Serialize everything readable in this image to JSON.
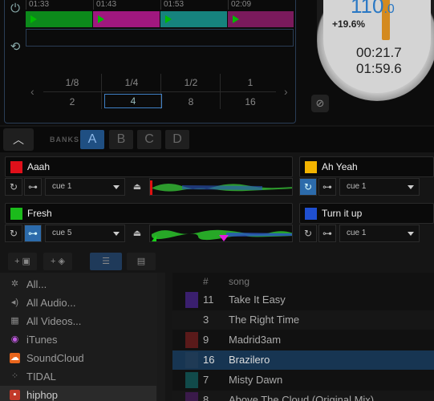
{
  "top": {
    "times": [
      "01:33",
      "01:43",
      "01:53",
      "02:09"
    ],
    "clip_colors": [
      "#0c8a1b",
      "#a0187f",
      "#16837e",
      "#7a1a5c"
    ],
    "loop_icon": "loop-icon",
    "sync_icon": "sync-icon",
    "beat_top": [
      "1/8",
      "1/4",
      "1/2",
      "1"
    ],
    "beat_bottom": [
      "2",
      "4",
      "8",
      "16"
    ],
    "beat_selected": "4"
  },
  "jog": {
    "bpm_main": "110",
    "bpm_decimal": ".0",
    "pitch": "+19.6%",
    "elapsed": "00:21.7",
    "remaining": "01:59.6"
  },
  "banks": {
    "label": "BANKS",
    "items": [
      "A",
      "B",
      "C",
      "D"
    ],
    "active": "A"
  },
  "slots": [
    {
      "name": "Aaah",
      "color": "#e0101a",
      "cue": "cue 1",
      "loop_active": false,
      "sync_active": false
    },
    {
      "name": "Ah Yeah",
      "color": "#f2b300",
      "cue": "cue 1",
      "loop_active": false,
      "sync_active": true
    },
    {
      "name": "Fresh",
      "color": "#1bbb1b",
      "cue": "cue 5",
      "loop_active": true,
      "sync_active": false
    },
    {
      "name": "Turn it up",
      "color": "#1f4fd0",
      "cue": "cue 1",
      "loop_active": false,
      "sync_active": false
    }
  ],
  "browser": {
    "sidebar": [
      {
        "label": "All...",
        "icon": "gear-icon"
      },
      {
        "label": "All Audio...",
        "icon": "speaker-icon"
      },
      {
        "label": "All Videos...",
        "icon": "film-icon"
      },
      {
        "label": "iTunes",
        "icon": "itunes-icon"
      },
      {
        "label": "SoundCloud",
        "icon": "soundcloud-icon"
      },
      {
        "label": "TIDAL",
        "icon": "tidal-icon"
      },
      {
        "label": "hiphop",
        "icon": "folder-icon"
      }
    ],
    "columns": {
      "num": "#",
      "song": "song"
    },
    "tracks": [
      {
        "num": "11",
        "song": "Take It Easy",
        "color": "#3a1f6e"
      },
      {
        "num": "3",
        "song": "The Right Time",
        "color": "#161616"
      },
      {
        "num": "9",
        "song": "Madrid3am",
        "color": "#5a1a1a"
      },
      {
        "num": "16",
        "song": "Brazilero",
        "color": "#1f3a55"
      },
      {
        "num": "7",
        "song": "Misty Dawn",
        "color": "#114a4a"
      },
      {
        "num": "8",
        "song": "Above The Cloud (Original Mix)",
        "color": "#3a1a4a"
      }
    ]
  }
}
